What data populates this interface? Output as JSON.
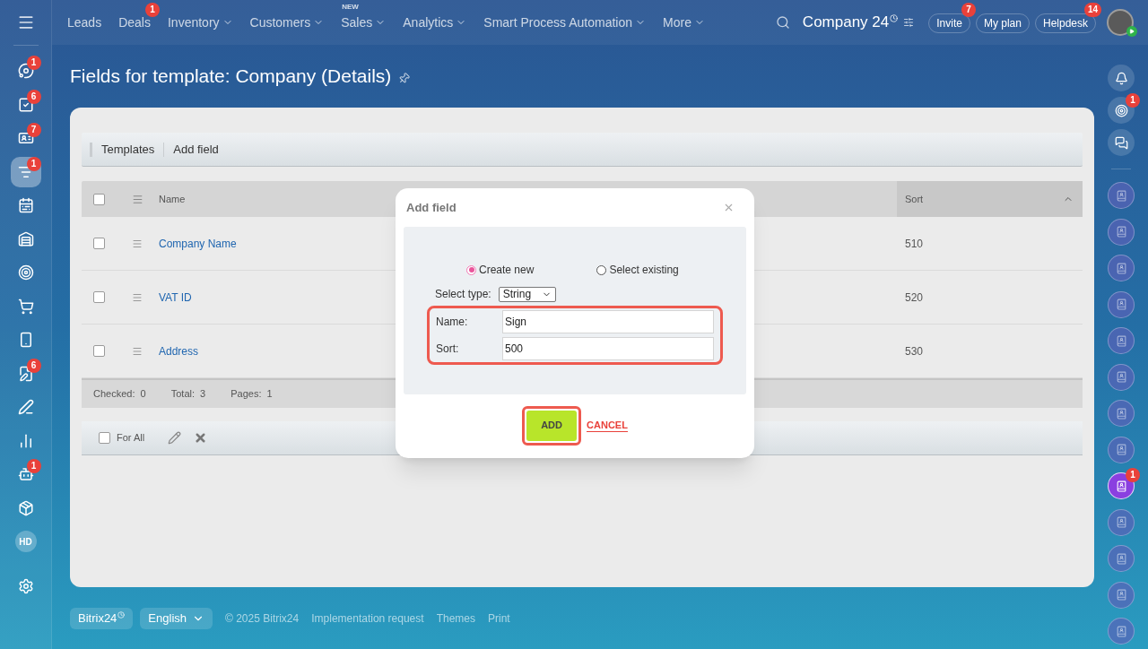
{
  "sidebar": {
    "items": [
      {
        "kind": "icon",
        "badge": "1",
        "selected": false
      },
      {
        "kind": "icon",
        "badge": "6",
        "selected": false
      },
      {
        "kind": "icon",
        "badge": "7",
        "selected": false
      },
      {
        "kind": "icon",
        "badge": "1",
        "selected": true
      },
      {
        "kind": "icon",
        "selected": false
      },
      {
        "kind": "icon",
        "selected": false
      },
      {
        "kind": "icon",
        "selected": false
      },
      {
        "kind": "icon",
        "selected": false
      },
      {
        "kind": "icon",
        "selected": false
      },
      {
        "kind": "icon",
        "badge": "6",
        "selected": false
      },
      {
        "kind": "icon",
        "selected": false
      },
      {
        "kind": "icon",
        "selected": false
      },
      {
        "kind": "icon",
        "badge": "1",
        "selected": false
      },
      {
        "kind": "icon",
        "selected": false
      },
      {
        "kind": "initials",
        "label": "HD",
        "selected": false
      }
    ]
  },
  "nav": [
    {
      "label": "Leads",
      "has_menu": false
    },
    {
      "label": "Deals",
      "badge": "1",
      "has_menu": false
    },
    {
      "label": "Inventory",
      "has_menu": true
    },
    {
      "label": "Customers",
      "has_menu": true
    },
    {
      "label": "Sales",
      "tag": "NEW",
      "has_menu": true
    },
    {
      "label": "Analytics",
      "has_menu": true
    },
    {
      "label": "Smart Process Automation",
      "has_menu": true
    },
    {
      "label": "More",
      "has_menu": true
    }
  ],
  "header": {
    "company": "Company 24",
    "buttons": [
      {
        "label": "Invite",
        "badge": "7"
      },
      {
        "label": "My plan"
      },
      {
        "label": "Helpdesk",
        "badge": "14"
      }
    ]
  },
  "page_title": "Fields for template: Company (Details)",
  "toolbar": [
    "Templates",
    "Add field"
  ],
  "table": {
    "header_checked": false,
    "columns": [
      {
        "label": "Name",
        "sorted": false
      },
      {
        "label": "Sort",
        "sorted": true
      }
    ],
    "rows": [
      {
        "name": "Company Name",
        "sort": "510",
        "checked": false
      },
      {
        "name": "VAT ID",
        "sort": "520",
        "checked": false
      },
      {
        "name": "Address",
        "sort": "530",
        "checked": false
      }
    ],
    "summary": [
      {
        "label": "Checked:",
        "value": "0"
      },
      {
        "label": "Total:",
        "value": "3"
      },
      {
        "label": "Pages:",
        "value": "1"
      }
    ],
    "for_all": {
      "label": "For All",
      "checked": false
    }
  },
  "modal": {
    "title": "Add field",
    "options": [
      {
        "label": "Create new",
        "selected": true
      },
      {
        "label": "Select existing",
        "selected": false
      }
    ],
    "type_label": "Select type:",
    "type_value": "String",
    "fields": [
      {
        "label": "Name:",
        "value": "Sign"
      },
      {
        "label": "Sort:",
        "value": "500"
      }
    ],
    "add": "ADD",
    "cancel": "CANCEL"
  },
  "right_rail": {
    "tools": [
      {
        "kind": "bell"
      },
      {
        "kind": "target",
        "badge": "1"
      },
      {
        "kind": "chat"
      }
    ],
    "contacts": [
      {
        "selected": false
      },
      {
        "selected": false
      },
      {
        "selected": false
      },
      {
        "selected": false
      },
      {
        "selected": false
      },
      {
        "selected": false
      },
      {
        "selected": false
      },
      {
        "selected": false
      },
      {
        "selected": true,
        "badge": "1"
      },
      {
        "selected": false
      },
      {
        "selected": false
      },
      {
        "selected": false
      },
      {
        "selected": false
      }
    ]
  },
  "footer": {
    "brand": "Bitrix24",
    "language": "English",
    "copyright": "© 2025 Bitrix24",
    "links": [
      "Implementation request",
      "Themes",
      "Print"
    ]
  }
}
